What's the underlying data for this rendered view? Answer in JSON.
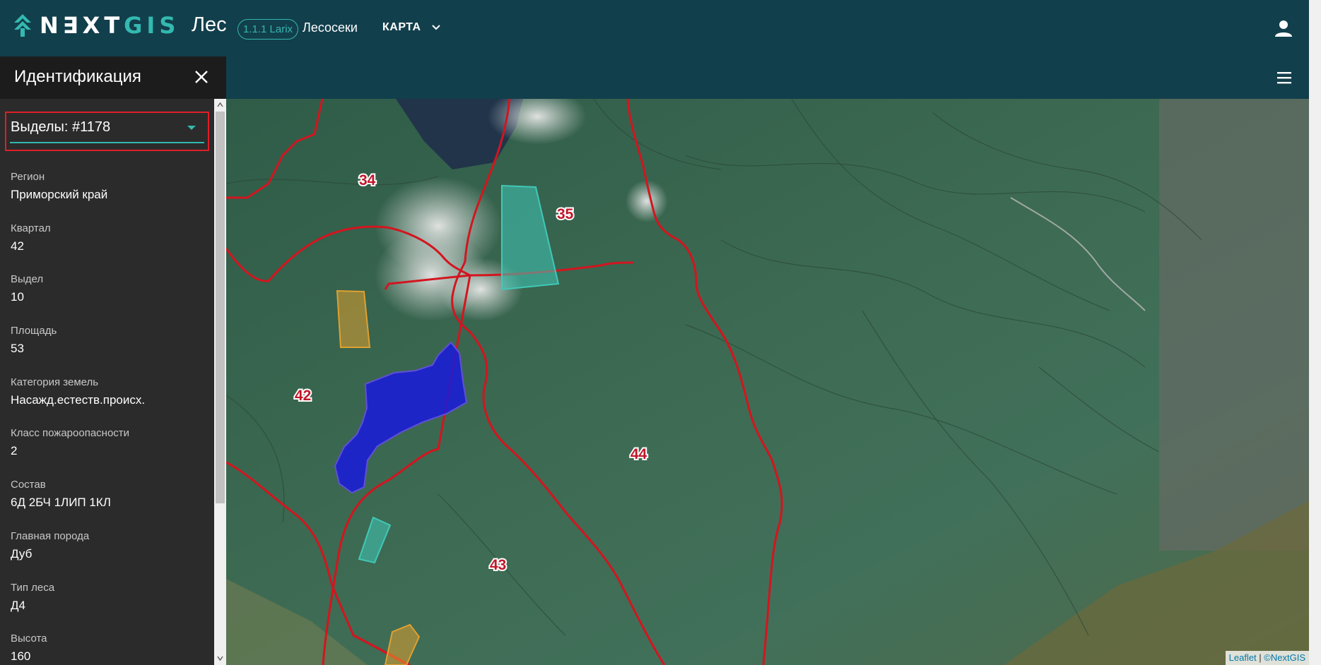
{
  "header": {
    "logo_part1": "N∃XT",
    "logo_part2": "GIS",
    "app_name": "Лес",
    "version": "1.1.1 Larix",
    "nav_cutting": "Лесосеки",
    "nav_map": "КАРТА"
  },
  "panel": {
    "title": "Идентификация",
    "selected_feature": "Выделы: #1178",
    "fields": [
      {
        "label": "Регион",
        "value": "Приморский край"
      },
      {
        "label": "Квартал",
        "value": "42"
      },
      {
        "label": "Выдел",
        "value": "10"
      },
      {
        "label": "Площадь",
        "value": "53"
      },
      {
        "label": "Категория земель",
        "value": "Насажд.естеств.происх."
      },
      {
        "label": "Класс пожароопасности",
        "value": "2"
      },
      {
        "label": "Состав",
        "value": "6Д 2БЧ 1ЛИП 1КЛ"
      },
      {
        "label": "Главная порода",
        "value": "Дуб"
      },
      {
        "label": "Тип леса",
        "value": "Д4"
      },
      {
        "label": "Высота",
        "value": "160"
      }
    ]
  },
  "map": {
    "quarter_labels": [
      "34",
      "35",
      "42",
      "44",
      "43"
    ],
    "attribution": {
      "leaflet": "Leaflet",
      "separator": " | ",
      "nextgis": "©NextGIS"
    },
    "colors": {
      "boundary": "#d3151f",
      "selected_fill": "#1a1adb",
      "cutting_teal": "#40c8b8",
      "cutting_orange": "#e0a030"
    }
  },
  "icons": {
    "logo": "nextgis-logo-icon",
    "user": "user-icon",
    "menu": "hamburger-menu-icon",
    "close": "close-icon",
    "dropdown": "chevron-down-icon"
  }
}
